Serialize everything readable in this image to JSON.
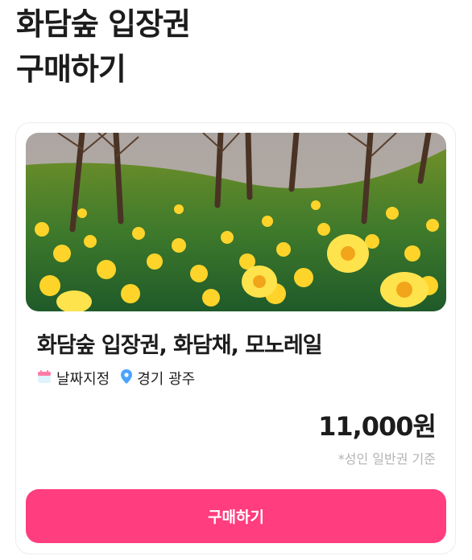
{
  "header": {
    "title_line1": "화담숲 입장권",
    "title_line2": "구매하기"
  },
  "product": {
    "title": "화담숲 입장권, 화담채, 모노레일",
    "date_label": "날짜지정",
    "location": "경기 광주",
    "price": "11,000원",
    "price_note": "*성인 일반권 기준",
    "image_alt": "Daffodil field under trees"
  },
  "buy_button_label": "구매하기",
  "colors": {
    "accent": "#ff3d7f",
    "pin": "#4aa3ff",
    "calendar": "#ff7aa8"
  },
  "icons": {
    "date": "calendar-icon",
    "location": "location-pin-icon"
  }
}
